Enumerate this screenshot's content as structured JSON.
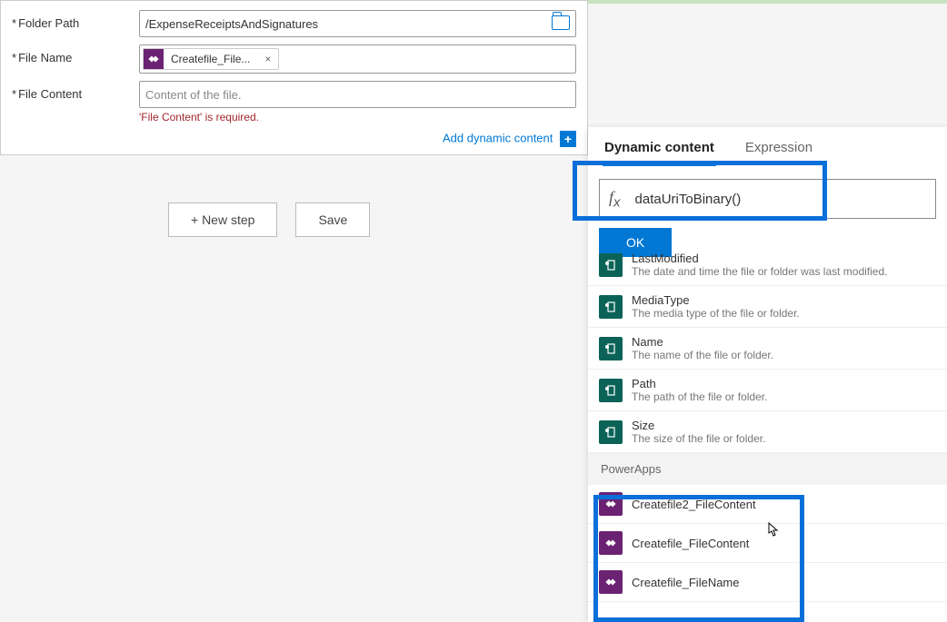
{
  "form": {
    "folderPath": {
      "label": "Folder Path",
      "value": "/ExpenseReceiptsAndSignatures"
    },
    "fileName": {
      "label": "File Name",
      "tokenLabel": "Createfile_File..."
    },
    "fileContent": {
      "label": "File Content",
      "placeholder": "Content of the file.",
      "error": "'File Content' is required."
    },
    "addDynamic": "Add dynamic content"
  },
  "footer": {
    "newStep": "+ New step",
    "save": "Save"
  },
  "panel": {
    "tab1": "Dynamic content",
    "tab2": "Expression",
    "fxValue": "dataUriToBinary()",
    "ok": "OK",
    "items": [
      {
        "title": "LastModified",
        "desc": "The date and time the file or folder was last modified."
      },
      {
        "title": "MediaType",
        "desc": "The media type of the file or folder."
      },
      {
        "title": "Name",
        "desc": "The name of the file or folder."
      },
      {
        "title": "Path",
        "desc": "The path of the file or folder."
      },
      {
        "title": "Size",
        "desc": "The size of the file or folder."
      }
    ],
    "section2": "PowerApps",
    "paItems": [
      {
        "title": "Createfile2_FileContent"
      },
      {
        "title": "Createfile_FileContent"
      },
      {
        "title": "Createfile_FileName"
      }
    ]
  }
}
